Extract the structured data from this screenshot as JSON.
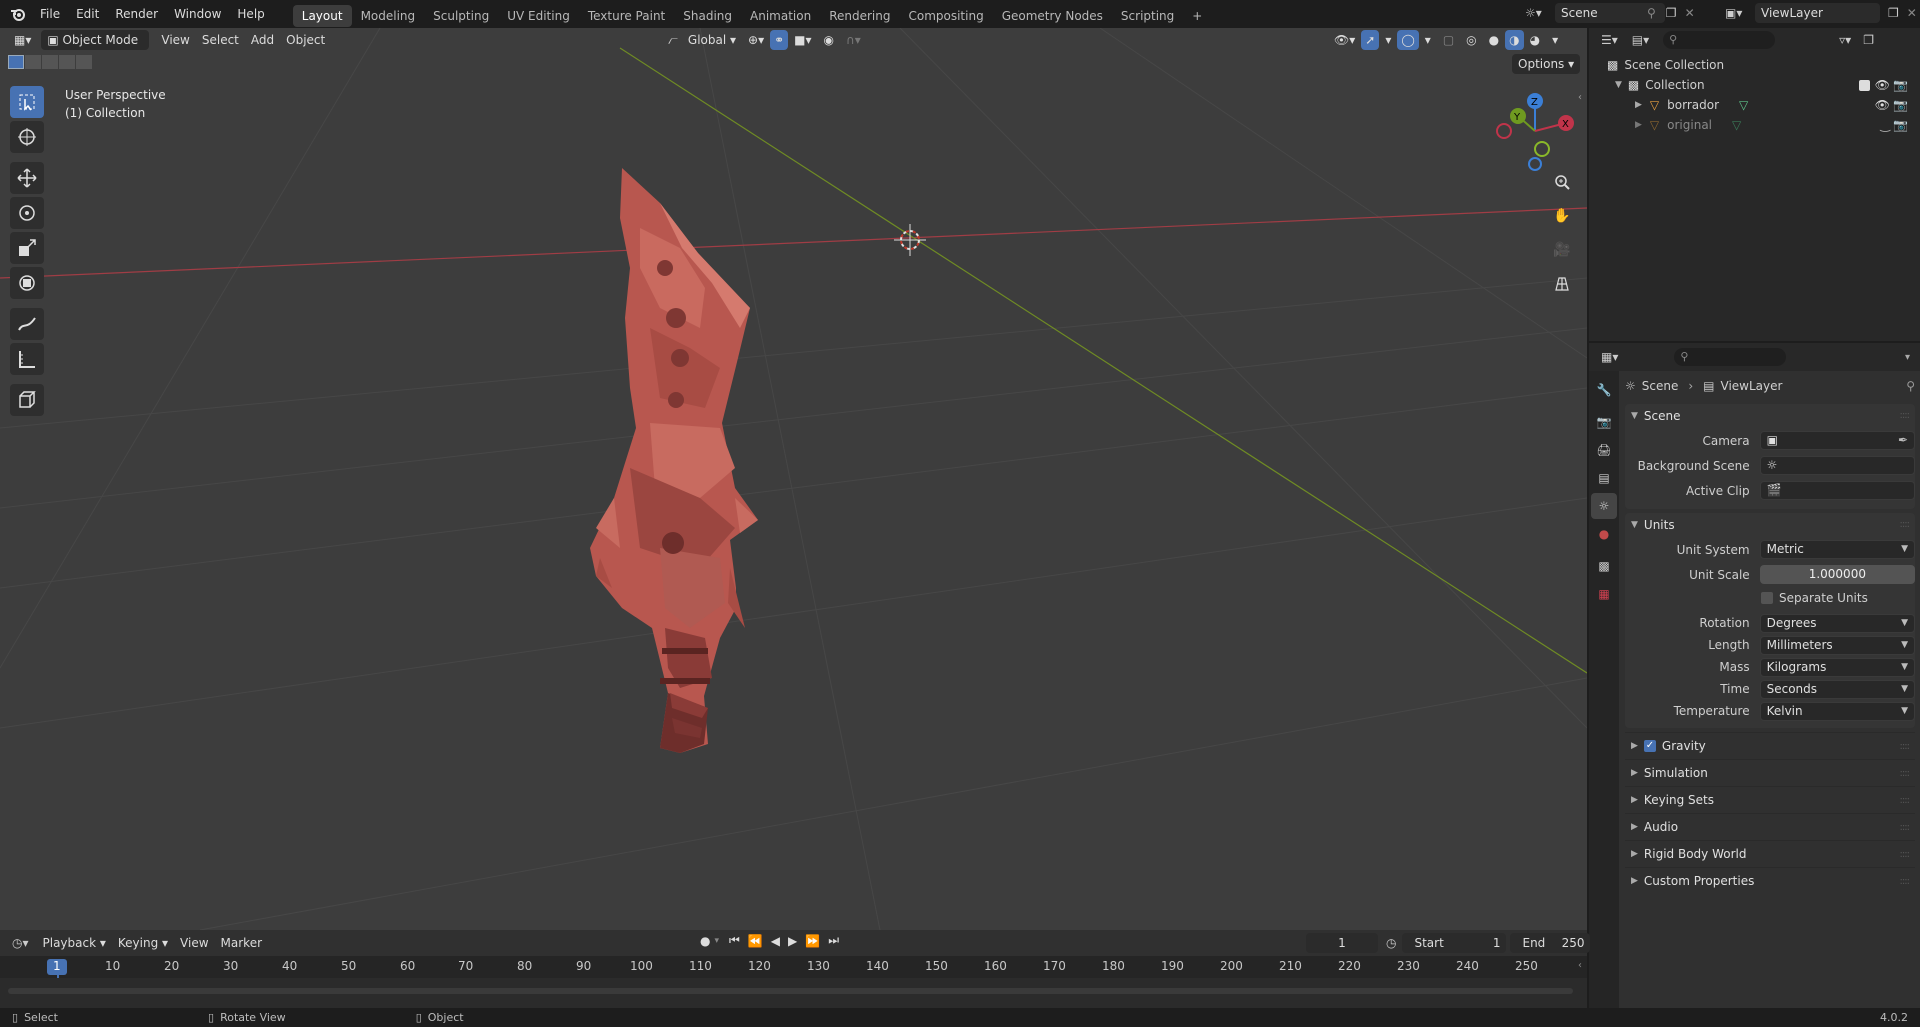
{
  "menubar": {
    "items": [
      "File",
      "Edit",
      "Render",
      "Window",
      "Help"
    ],
    "workspaces": [
      "Layout",
      "Modeling",
      "Sculpting",
      "UV Editing",
      "Texture Paint",
      "Shading",
      "Animation",
      "Rendering",
      "Compositing",
      "Geometry Nodes",
      "Scripting"
    ],
    "active_workspace": "Layout",
    "add_tab": "+",
    "scene_name": "Scene",
    "view_layer_name": "ViewLayer"
  },
  "viewport": {
    "mode": "Object Mode",
    "menus": [
      "View",
      "Select",
      "Add",
      "Object"
    ],
    "orientation": "Global",
    "options_label": "Options",
    "overlay_line1": "User Perspective",
    "overlay_line2": "(1) Collection",
    "gizmo": {
      "z": "Z",
      "y": "Y",
      "x": "X"
    },
    "colors": {
      "background": "#3d3d3d",
      "x_axis": "#a03d45",
      "y_axis": "#6f8b24",
      "model": "#c4655a"
    }
  },
  "outliner": {
    "root": "Scene Collection",
    "collection": "Collection",
    "objects": [
      {
        "name": "borrador",
        "visible": true
      },
      {
        "name": "original",
        "visible": false
      }
    ]
  },
  "properties": {
    "breadcrumb": {
      "scene": "Scene",
      "view_layer": "ViewLayer"
    },
    "scene_panel": {
      "title": "Scene",
      "camera_label": "Camera",
      "background_scene_label": "Background Scene",
      "active_clip_label": "Active Clip"
    },
    "units_panel": {
      "title": "Units",
      "unit_system_label": "Unit System",
      "unit_system": "Metric",
      "unit_scale_label": "Unit Scale",
      "unit_scale": "1.000000",
      "separate_units_label": "Separate Units",
      "separate_units": false,
      "rotation_label": "Rotation",
      "rotation": "Degrees",
      "length_label": "Length",
      "length": "Millimeters",
      "mass_label": "Mass",
      "mass": "Kilograms",
      "time_label": "Time",
      "time": "Seconds",
      "temperature_label": "Temperature",
      "temperature": "Kelvin"
    },
    "collapsed_panels": {
      "gravity": "Gravity",
      "simulation": "Simulation",
      "keying_sets": "Keying Sets",
      "audio": "Audio",
      "rigid_body_world": "Rigid Body World",
      "custom_properties": "Custom Properties"
    },
    "gravity_enabled": true
  },
  "timeline": {
    "menus": [
      "Playback",
      "Keying",
      "View",
      "Marker"
    ],
    "current_frame": "1",
    "start_label": "Start",
    "start": "1",
    "end_label": "End",
    "end": "250",
    "ruler": [
      "1",
      "10",
      "20",
      "30",
      "40",
      "50",
      "60",
      "70",
      "80",
      "90",
      "100",
      "110",
      "120",
      "130",
      "140",
      "150",
      "160",
      "170",
      "180",
      "190",
      "200",
      "210",
      "220",
      "230",
      "240",
      "250"
    ]
  },
  "statusbar": {
    "select": "Select",
    "rotate": "Rotate View",
    "object": "Object",
    "version": "4.0.2"
  }
}
